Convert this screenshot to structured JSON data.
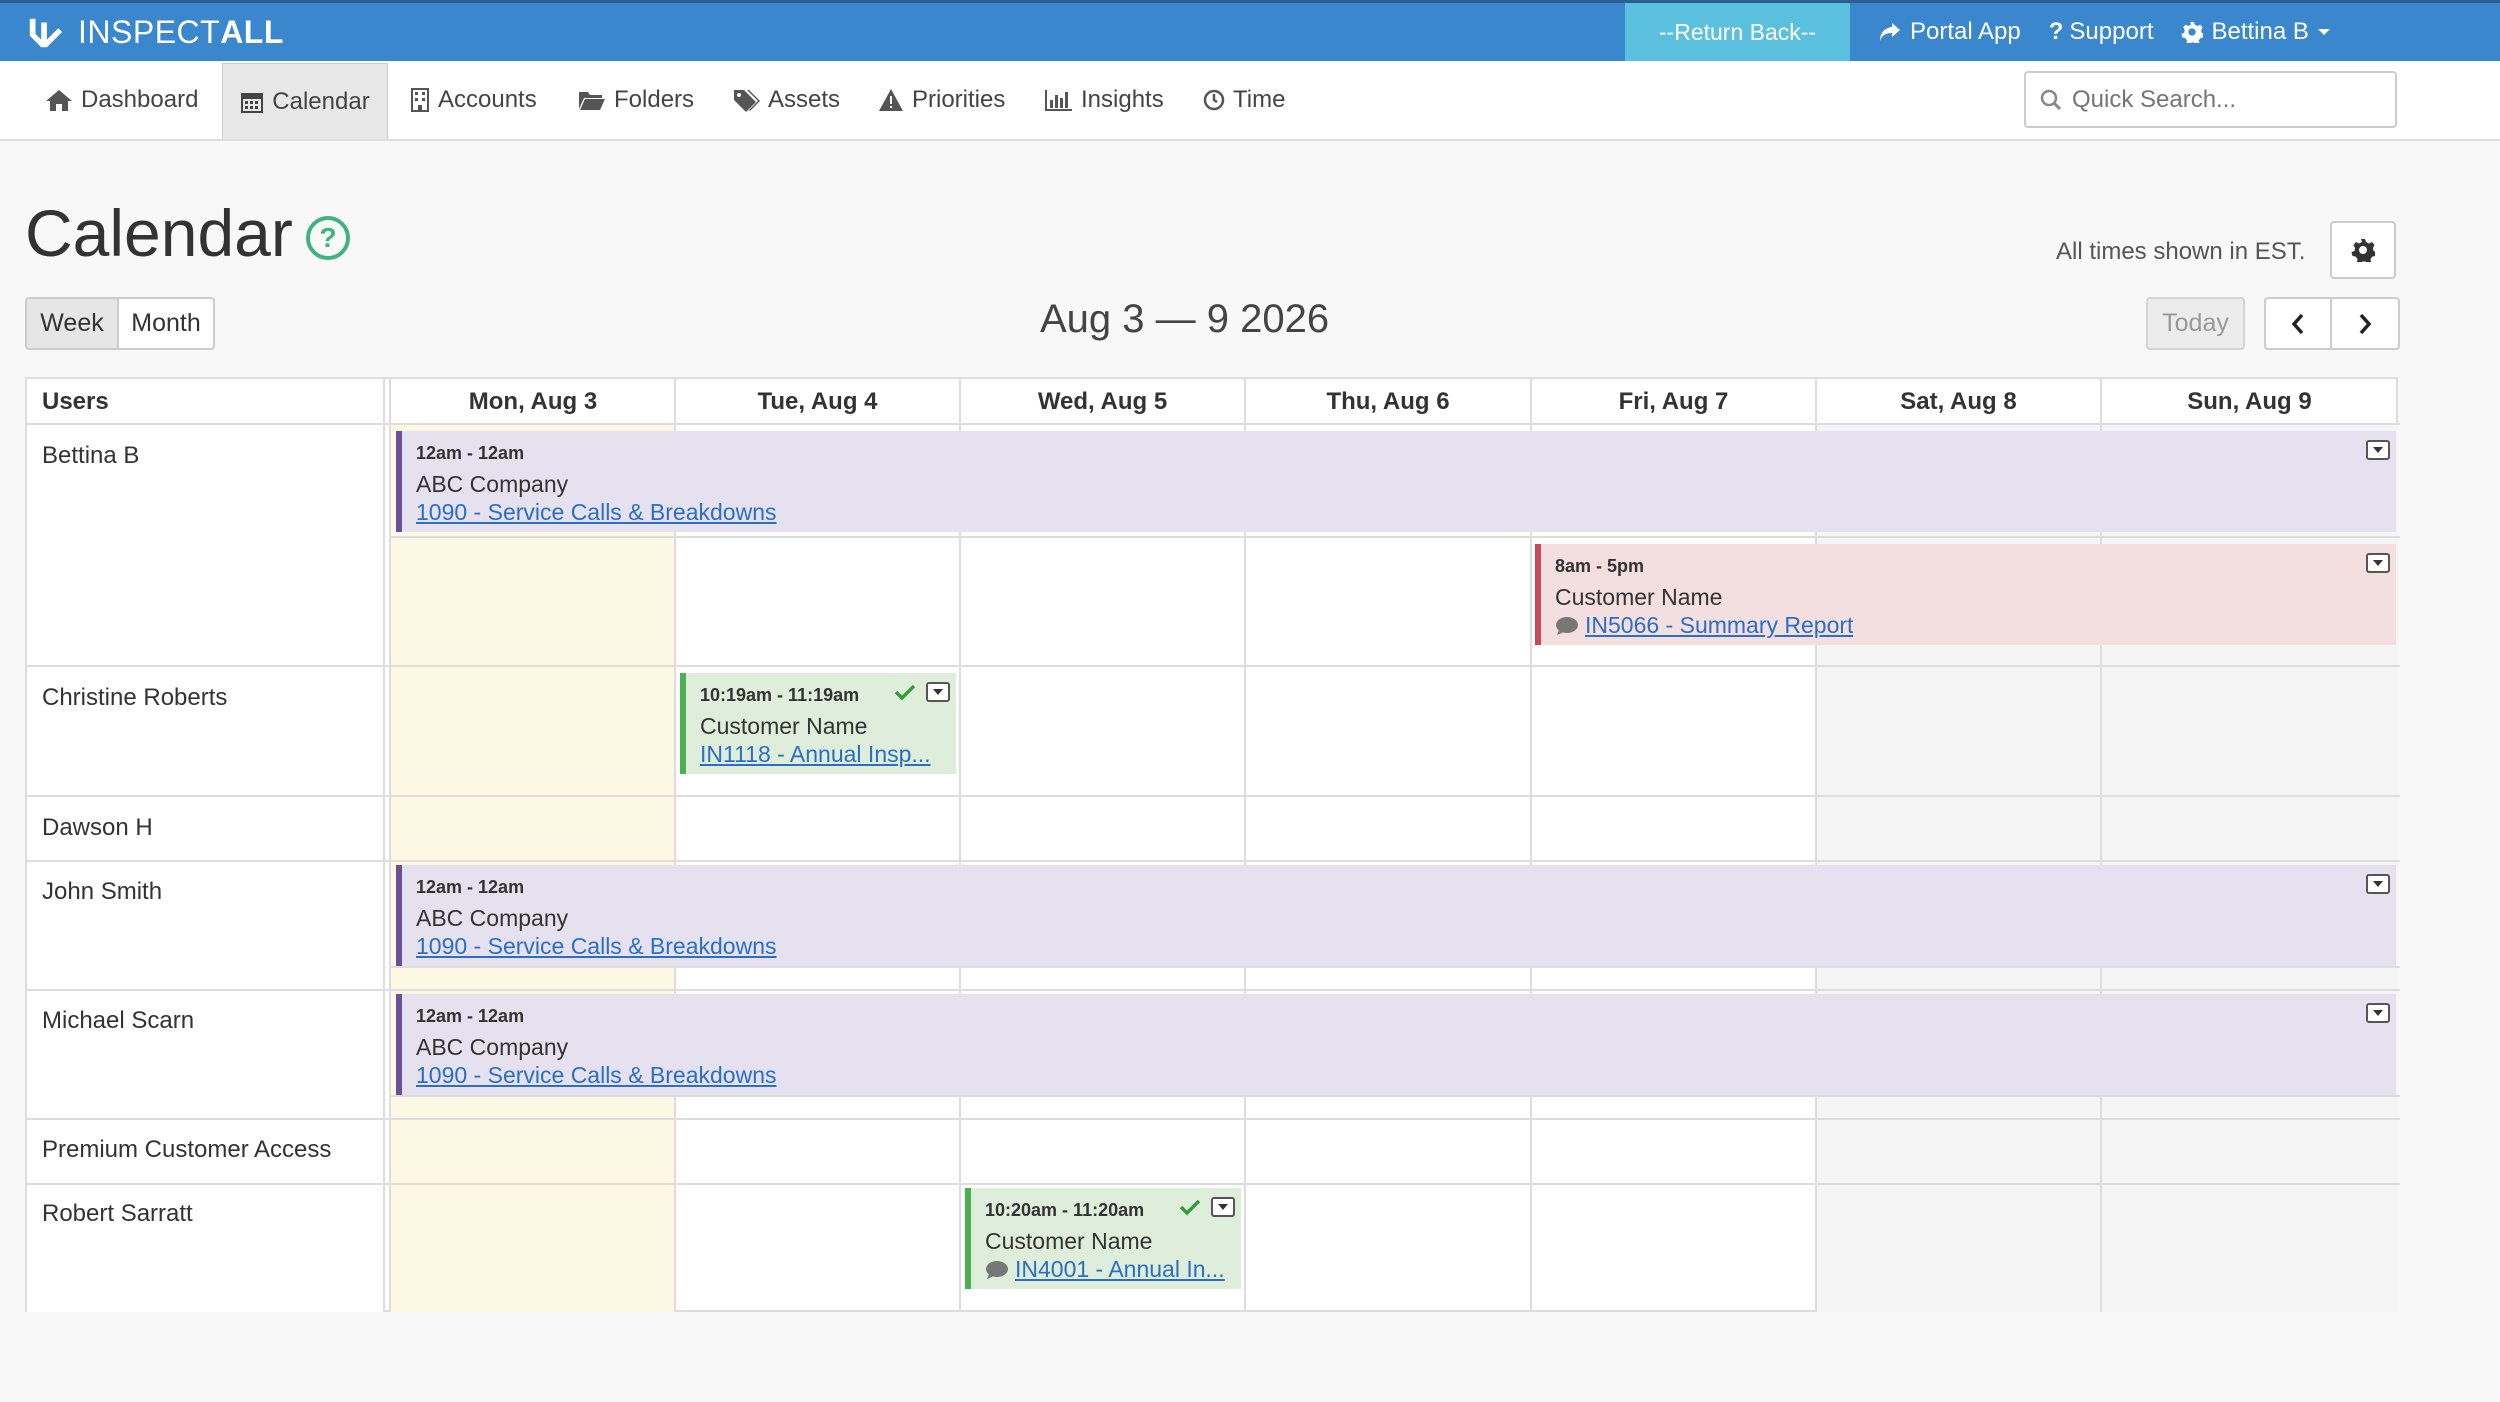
{
  "app": {
    "logo_light": "INSPECT",
    "logo_bold": "ALL"
  },
  "topnav": {
    "return_label": "--Return Back--",
    "portal_label": "Portal App",
    "support_label": "Support",
    "user_label": "Bettina B"
  },
  "nav": {
    "items": [
      {
        "label": "Dashboard",
        "icon": "home-icon"
      },
      {
        "label": "Calendar",
        "icon": "calendar-icon"
      },
      {
        "label": "Accounts",
        "icon": "building-icon"
      },
      {
        "label": "Folders",
        "icon": "folder-icon"
      },
      {
        "label": "Assets",
        "icon": "tags-icon"
      },
      {
        "label": "Priorities",
        "icon": "warning-icon"
      },
      {
        "label": "Insights",
        "icon": "bar-chart-icon"
      },
      {
        "label": "Time",
        "icon": "clock-icon"
      }
    ],
    "active": "Calendar",
    "search_placeholder": "Quick Search..."
  },
  "page": {
    "title": "Calendar",
    "help": "?",
    "timezone_note": "All times shown in EST.",
    "view_week": "Week",
    "view_month": "Month",
    "range": "Aug 3 — 9 2026",
    "today": "Today"
  },
  "calendar": {
    "users_header": "Users",
    "days": [
      "Mon, Aug 3",
      "Tue, Aug 4",
      "Wed, Aug 5",
      "Thu, Aug 6",
      "Fri, Aug 7",
      "Sat, Aug 8",
      "Sun, Aug 9"
    ],
    "users": [
      "Bettina B",
      "Christine Roberts",
      "Dawson H",
      "John Smith",
      "Michael Scarn",
      "Premium Customer Access",
      "Robert Sarratt"
    ],
    "events": [
      {
        "user": "Bettina B",
        "time": "12am - 12am",
        "name": "ABC Company",
        "link": "1090 - Service Calls & Breakdowns",
        "color": "#6b4e94"
      },
      {
        "user": "Bettina B",
        "time": "8am - 5pm",
        "name": "Customer Name",
        "link": "IN5066 - Summary Report",
        "color": "#c94b55"
      },
      {
        "user": "Christine Roberts",
        "time": "10:19am - 11:19am",
        "name": "Customer Name",
        "link": "IN1118 - Annual Insp...",
        "color": "#4caf50"
      },
      {
        "user": "John Smith",
        "time": "12am - 12am",
        "name": "ABC Company",
        "link": "1090 - Service Calls & Breakdowns",
        "color": "#6b4e94"
      },
      {
        "user": "Michael Scarn",
        "time": "12am - 12am",
        "name": "ABC Company",
        "link": "1090 - Service Calls & Breakdowns",
        "color": "#6b4e94"
      },
      {
        "user": "Robert Sarratt",
        "time": "10:20am - 11:20am",
        "name": "Customer Name",
        "link": "IN4001 - Annual In...",
        "color": "#4caf50"
      }
    ]
  }
}
